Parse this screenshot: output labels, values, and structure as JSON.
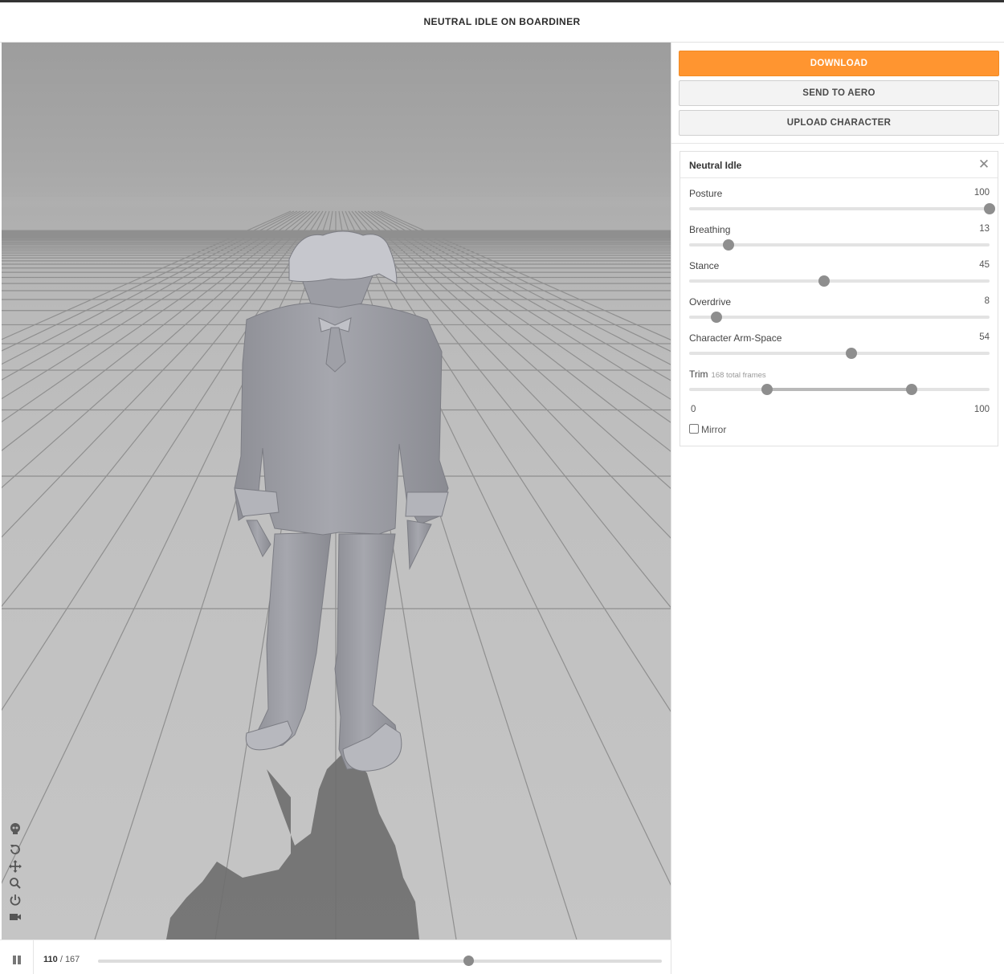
{
  "header": {
    "title": "NEUTRAL IDLE ON BOARDINER"
  },
  "viewport_tools": [
    {
      "icon": "skeleton-skull-icon",
      "interactable": true
    },
    {
      "icon": "reset-rotate-icon",
      "interactable": true
    },
    {
      "icon": "pan-move-icon",
      "interactable": true
    },
    {
      "icon": "zoom-search-icon",
      "interactable": true
    },
    {
      "icon": "power-icon",
      "interactable": true
    },
    {
      "icon": "camera-video-icon",
      "interactable": true
    }
  ],
  "playback": {
    "state_icon": "pause-icon",
    "current_frame": "110",
    "separator": "/",
    "total_frames": "167",
    "progress": 0.656
  },
  "actions": {
    "download_label": "DOWNLOAD",
    "send_label": "SEND TO AERO",
    "upload_label": "UPLOAD CHARACTER",
    "primary_color": "#ff9530"
  },
  "panel": {
    "title": "Neutral Idle",
    "close_icon": "close-icon",
    "params": [
      {
        "label": "Posture",
        "value": "100",
        "fraction": 1.0
      },
      {
        "label": "Breathing",
        "value": "13",
        "fraction": 0.13
      },
      {
        "label": "Stance",
        "value": "45",
        "fraction": 0.45
      },
      {
        "label": "Overdrive",
        "value": "8",
        "fraction": 0.09
      },
      {
        "label": "Character Arm-Space",
        "value": "54",
        "fraction": 0.54
      }
    ],
    "trim": {
      "label": "Trim",
      "subtitle": "168 total frames",
      "min_label": "0",
      "max_label": "100",
      "start_fraction": 0.26,
      "end_fraction": 0.74
    },
    "mirror": {
      "label": "Mirror",
      "checked": false
    }
  }
}
